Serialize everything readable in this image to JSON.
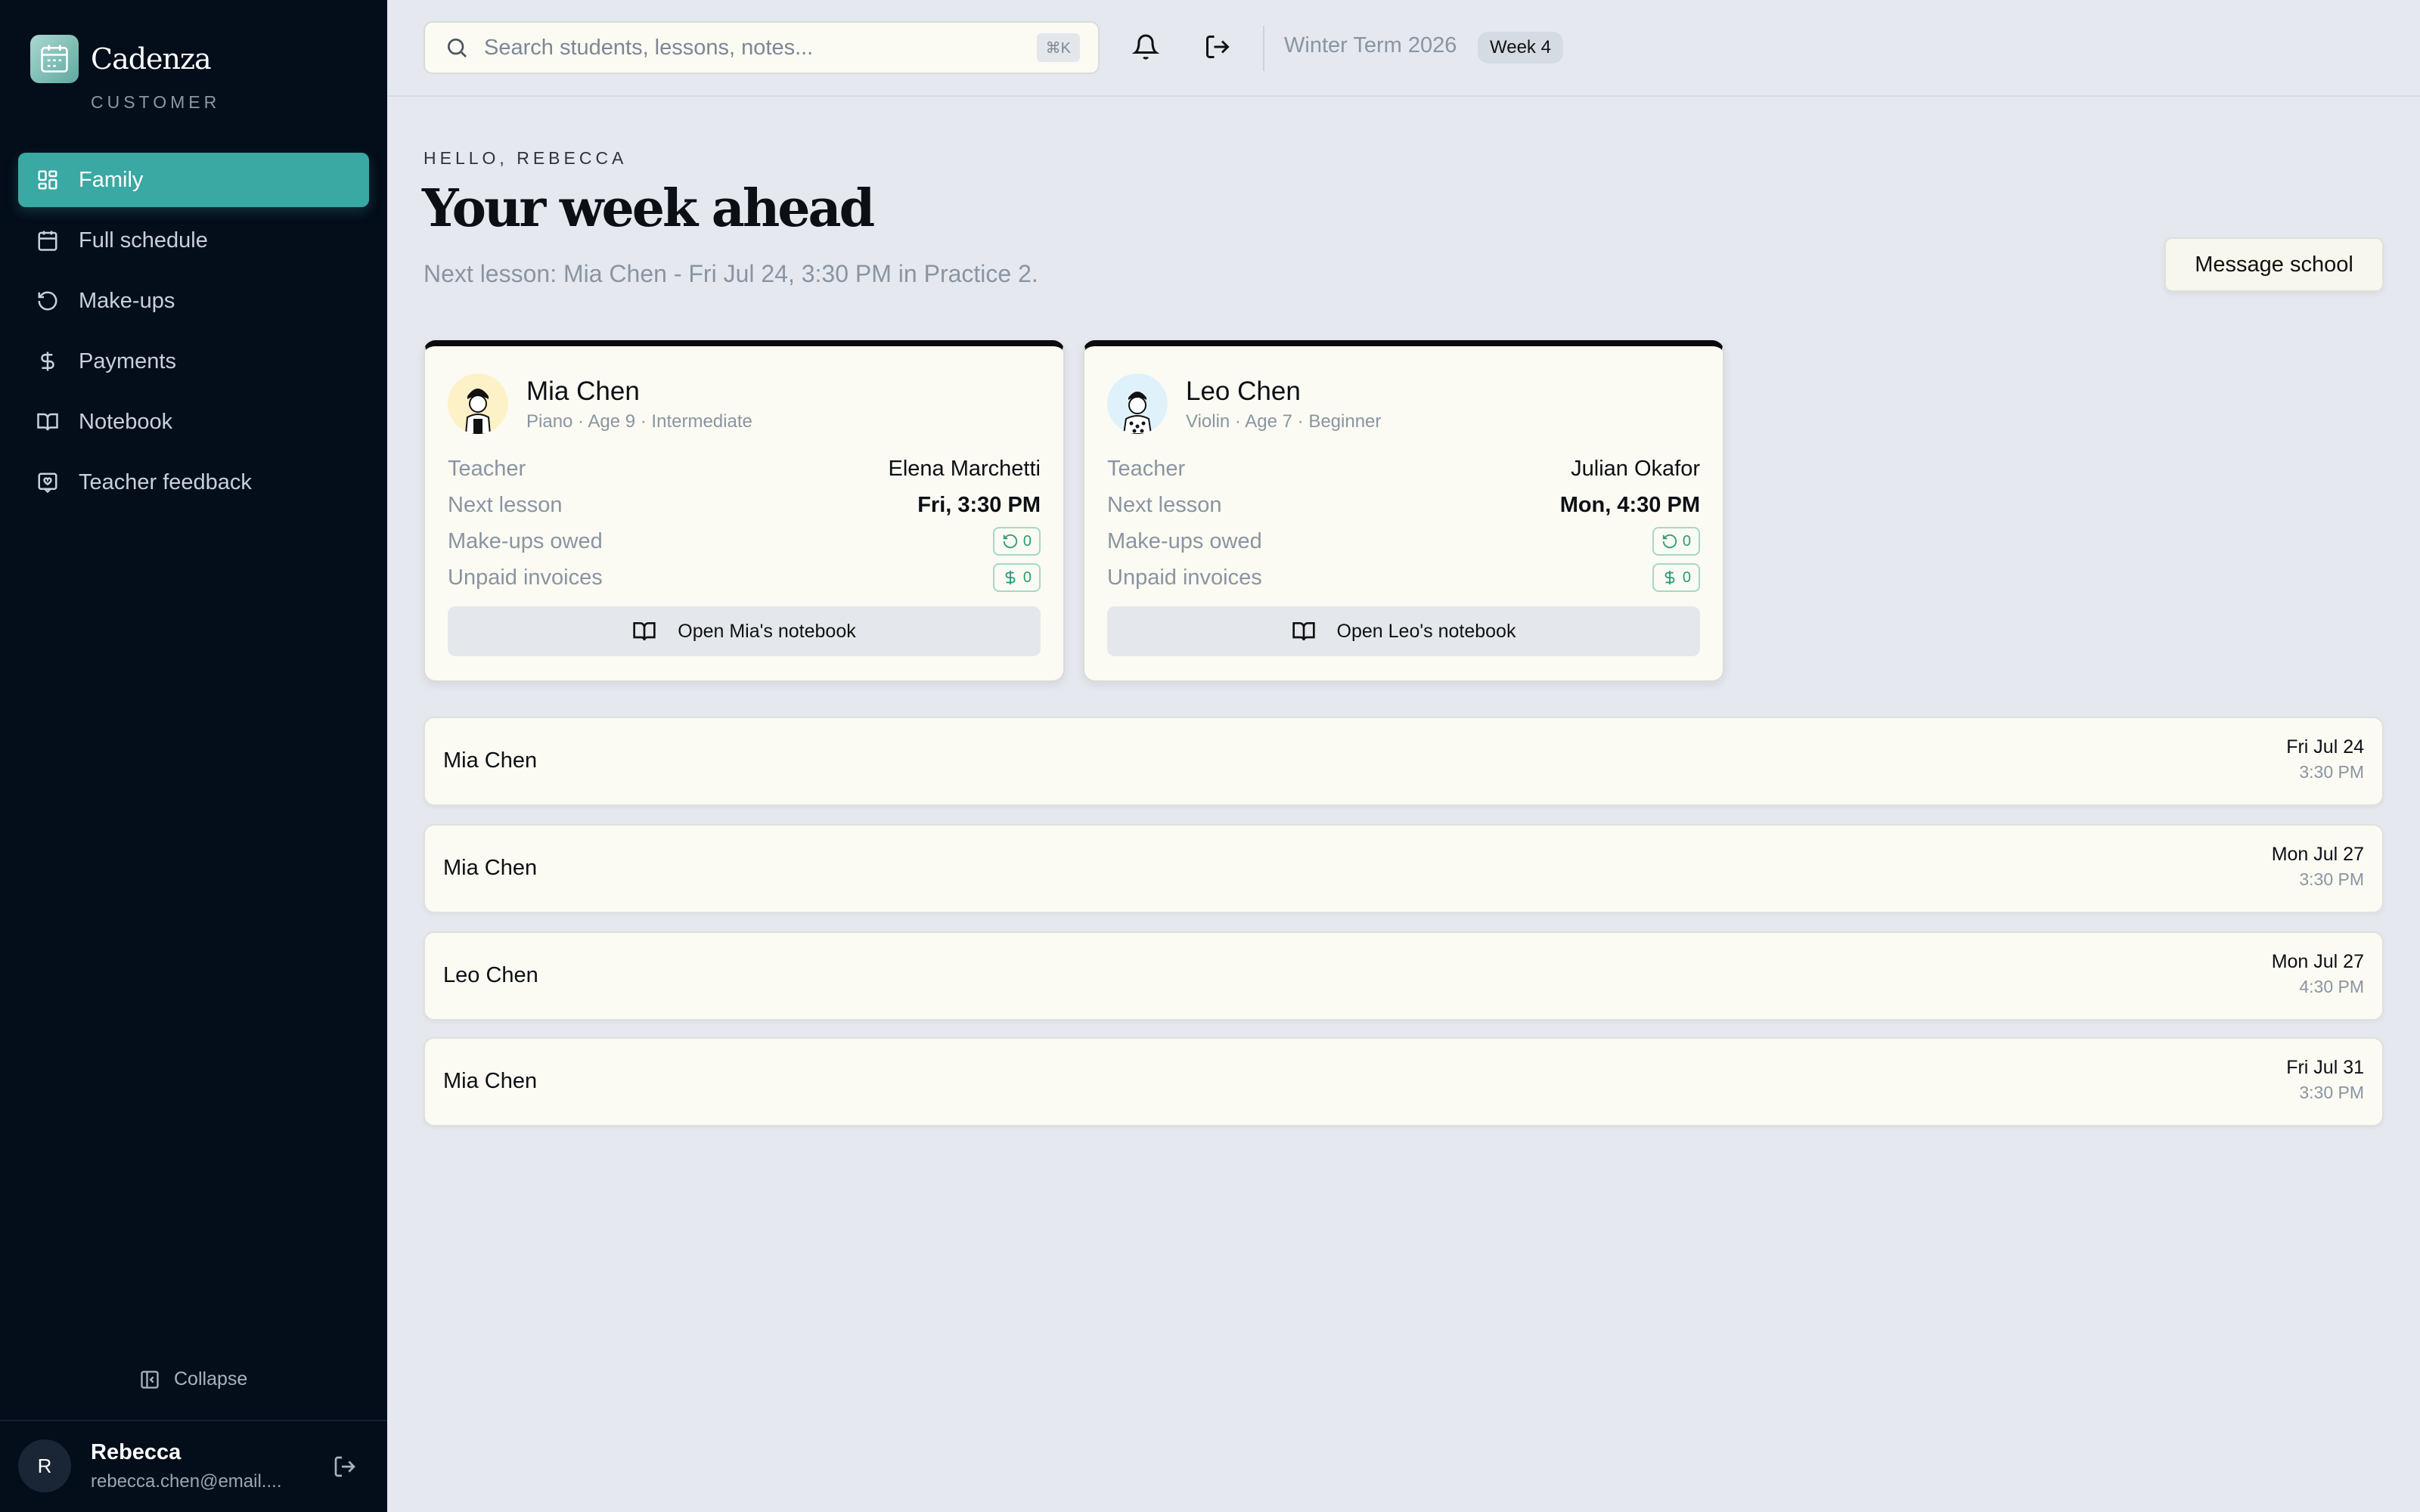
{
  "brand": {
    "name": "Cadenza",
    "subtitle": "CUSTOMER"
  },
  "sidebar": {
    "items": [
      {
        "label": "Family",
        "icon": "grid-icon",
        "active": true
      },
      {
        "label": "Full schedule",
        "icon": "calendar-icon"
      },
      {
        "label": "Make-ups",
        "icon": "refresh-icon"
      },
      {
        "label": "Payments",
        "icon": "dollar-icon"
      },
      {
        "label": "Notebook",
        "icon": "book-open-icon"
      },
      {
        "label": "Teacher feedback",
        "icon": "message-square-icon"
      }
    ],
    "collapse_label": "Collapse",
    "user": {
      "initial": "R",
      "name": "Rebecca",
      "email": "rebecca.chen@email...."
    }
  },
  "topbar": {
    "search_placeholder": "Search students, lessons, notes...",
    "search_shortcut": "⌘K",
    "term": "Winter Term 2026",
    "week": "Week 4"
  },
  "main": {
    "greeting": "HELLO, REBECCA",
    "title": "Your week ahead",
    "next_lesson": "Next lesson: Mia Chen - Fri Jul 24, 3:30 PM in Practice 2.",
    "message_button": "Message school"
  },
  "students": [
    {
      "name": "Mia Chen",
      "meta": "Piano · Age 9 · Intermediate",
      "avatar_bg": "#fdf1c8",
      "teacher_label": "Teacher",
      "teacher": "Elena Marchetti",
      "next_label": "Next lesson",
      "next": "Fri, 3:30 PM",
      "makeups_label": "Make-ups owed",
      "makeups": "0",
      "invoices_label": "Unpaid invoices",
      "invoices": "0",
      "notebook_button": "Open Mia's notebook"
    },
    {
      "name": "Leo Chen",
      "meta": "Violin · Age 7 · Beginner",
      "avatar_bg": "#dff1fb",
      "teacher_label": "Teacher",
      "teacher": "Julian Okafor",
      "next_label": "Next lesson",
      "next": "Mon, 4:30 PM",
      "makeups_label": "Make-ups owed",
      "makeups": "0",
      "invoices_label": "Unpaid invoices",
      "invoices": "0",
      "notebook_button": "Open Leo's notebook"
    }
  ],
  "schedule": [
    {
      "name": "Mia Chen",
      "date": "Fri Jul 24",
      "time": "3:30 PM"
    },
    {
      "name": "Mia Chen",
      "date": "Mon Jul 27",
      "time": "3:30 PM"
    },
    {
      "name": "Leo Chen",
      "date": "Mon Jul 27",
      "time": "4:30 PM"
    },
    {
      "name": "Mia Chen",
      "date": "Fri Jul 31",
      "time": "3:30 PM"
    }
  ],
  "colors": {
    "accent": "#3aa8a3",
    "sidebar_bg": "#040d1a",
    "page_bg": "#e5e9ef",
    "card_bg": "#fbfbf3",
    "positive": "#2c9a7a"
  }
}
